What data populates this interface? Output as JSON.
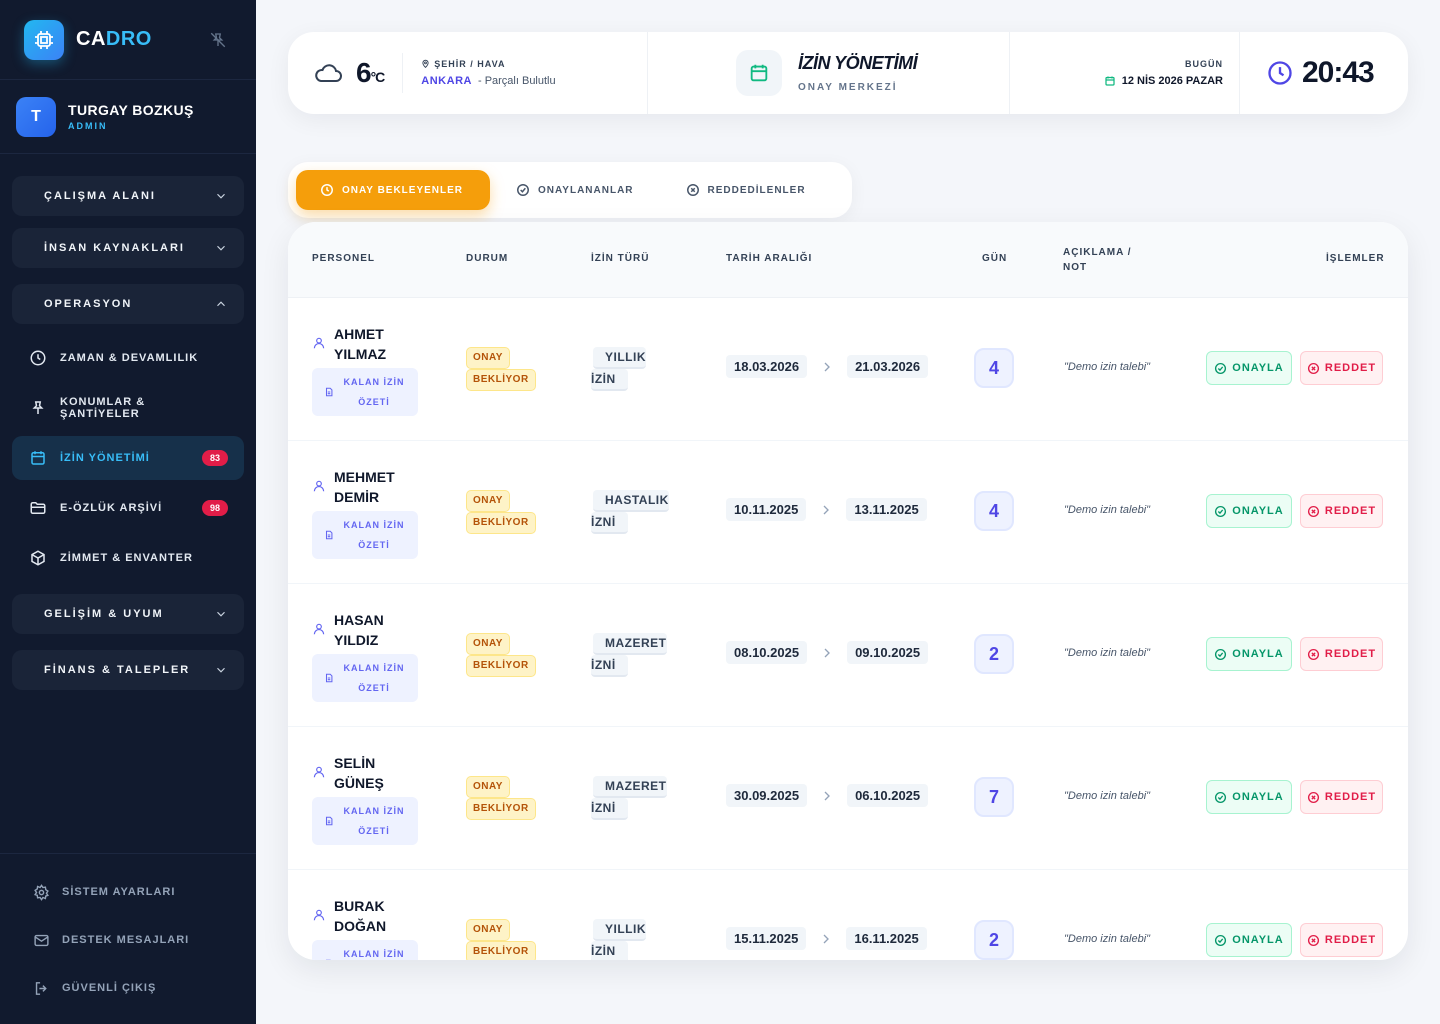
{
  "brand": {
    "part1": "CA",
    "part2": "DRO"
  },
  "user": {
    "initial": "T",
    "name": "TURGAY BOZKUŞ",
    "role": "ADMIN"
  },
  "nav": {
    "groups_top": [
      {
        "label": "ÇALIŞMA ALANI",
        "expanded": false
      },
      {
        "label": "İNSAN KAYNAKLARI",
        "expanded": false
      },
      {
        "label": "OPERASYON",
        "expanded": true
      }
    ],
    "items": [
      {
        "label": "ZAMAN & DEVAMLILIK",
        "icon": "clock-icon"
      },
      {
        "label": "KONUMLAR & ŞANTİYELER",
        "icon": "pin-icon"
      },
      {
        "label": "İZİN YÖNETİMİ",
        "icon": "calendar-icon",
        "badge": "83",
        "active": true
      },
      {
        "label": "E-ÖZLÜK ARŞİVİ",
        "icon": "folder-icon",
        "badge": "98"
      },
      {
        "label": "ZİMMET & ENVANTER",
        "icon": "box-icon"
      }
    ],
    "groups_bottom": [
      {
        "label": "GELİŞİM & UYUM",
        "expanded": false
      },
      {
        "label": "FİNANS & TALEPLER",
        "expanded": false
      }
    ],
    "bottom": [
      {
        "label": "SİSTEM AYARLARI",
        "icon": "gear-icon"
      },
      {
        "label": "DESTEK MESAJLARI",
        "icon": "mail-icon"
      },
      {
        "label": "GÜVENLİ ÇIKIŞ",
        "icon": "logout-icon"
      }
    ]
  },
  "topbar": {
    "temperature": "6",
    "unit": "°C",
    "location_label": "ŞEHİR / HAVA",
    "city": "ANKARA",
    "weather": "- Parçalı Bulutlu",
    "title": "İZİN YÖNETİMİ",
    "subtitle": "ONAY MERKEZİ",
    "today_label": "BUGÜN",
    "date": "12 NİS 2026 PAZAR",
    "time": "20:43"
  },
  "tabs": [
    {
      "label": "ONAY BEKLEYENLER",
      "active": true
    },
    {
      "label": "ONAYLANANLAR",
      "active": false
    },
    {
      "label": "REDDEDİLENLER",
      "active": false
    }
  ],
  "table": {
    "headers": {
      "personel": "PERSONEL",
      "durum": "DURUM",
      "izin_turu": "İZİN TÜRÜ",
      "tarih": "TARİH ARALIĞI",
      "gun": "GÜN",
      "aciklama_1": "AÇIKLAMA /",
      "aciklama_2": "NOT",
      "islemler": "İŞLEMLER"
    },
    "summary_label_1": "KALAN İZİN",
    "summary_label_2": "ÖZETİ",
    "approve_label": "ONAYLA",
    "reject_label": "REDDET",
    "rows": [
      {
        "first": "AHMET",
        "last": "YILMAZ",
        "status1": "ONAY",
        "status2": "BEKLİYOR",
        "type1": "YILLIK",
        "type2": "İZİN",
        "start": "18.03.2026",
        "end": "21.03.2026",
        "days": "4",
        "note": "\"Demo izin talebi\""
      },
      {
        "first": "MEHMET",
        "last": "DEMİR",
        "status1": "ONAY",
        "status2": "BEKLİYOR",
        "type1": "HASTALIK",
        "type2": "İZNİ",
        "start": "10.11.2025",
        "end": "13.11.2025",
        "days": "4",
        "note": "\"Demo izin talebi\""
      },
      {
        "first": "HASAN",
        "last": "YILDIZ",
        "status1": "ONAY",
        "status2": "BEKLİYOR",
        "type1": "MAZERET",
        "type2": "İZNİ",
        "start": "08.10.2025",
        "end": "09.10.2025",
        "days": "2",
        "note": "\"Demo izin talebi\""
      },
      {
        "first": "SELİN",
        "last": "GÜNEŞ",
        "status1": "ONAY",
        "status2": "BEKLİYOR",
        "type1": "MAZERET",
        "type2": "İZNİ",
        "start": "30.09.2025",
        "end": "06.10.2025",
        "days": "7",
        "note": "\"Demo izin talebi\""
      },
      {
        "first": "BURAK",
        "last": "DOĞAN",
        "status1": "ONAY",
        "status2": "BEKLİYOR",
        "type1": "YILLIK",
        "type2": "İZİN",
        "start": "15.11.2025",
        "end": "16.11.2025",
        "days": "2",
        "note": "\"Demo izin talebi\""
      }
    ]
  },
  "colors": {
    "sidebar_bg": "#111a2e",
    "accent": "#38bdf8",
    "active_tab": "#f59e0b",
    "approve": "#059669",
    "reject": "#e11d48",
    "badge": "#e11d48"
  }
}
